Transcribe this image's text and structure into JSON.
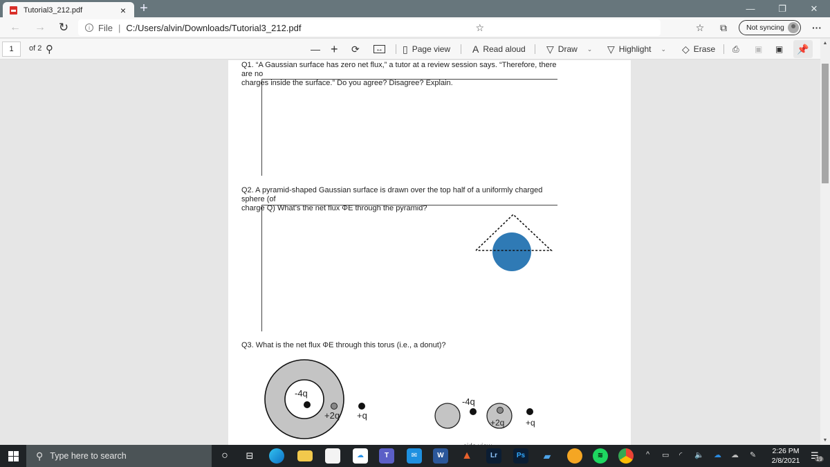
{
  "browser": {
    "tab_title": "Tutorial3_212.pdf",
    "tab_close": "×",
    "new_tab": "+",
    "window_controls": {
      "minimize": "—",
      "maximize": "❐",
      "close": "✕"
    },
    "address": {
      "scheme_label": "File",
      "separator": "|",
      "url": "C:/Users/alvin/Downloads/Tutorial3_212.pdf"
    },
    "nav": {
      "back": "←",
      "forward": "→",
      "refresh": "↻"
    },
    "toolbar_icons": [
      "add-favorite-icon",
      "favorites-icon",
      "collections-icon",
      "more-icon"
    ],
    "sync_label": "Not syncing",
    "more": "···"
  },
  "pdf_toolbar": {
    "page_current": "1",
    "page_total": "of 2",
    "zoom_out": "—",
    "zoom_in": "+",
    "page_view": "Page view",
    "read_aloud": "Read aloud",
    "draw": "Draw",
    "highlight": "Highlight",
    "erase": "Erase"
  },
  "document": {
    "q1_line1": "Q1. “A Gaussian surface has zero net flux,” a tutor at a review session says. “Therefore, there are no",
    "q1_line2": "charges inside the surface.” Do you agree? Disagree? Explain.",
    "q2_line1": "Q2.  A pyramid-shaped Gaussian surface is drawn over the top half of a uniformly charged sphere (of",
    "q2_line2": "charge Q) What’s the net flux ΦE through the pyramid?",
    "q3_text": "Q3. What is the net flux ΦE through this torus (i.e., a donut)?",
    "sphere_color": "#2f7ab5",
    "torus_labels": {
      "inner": "-4q",
      "mid": "+2q",
      "outer": "+q"
    },
    "side_labels": {
      "inner": "-4q",
      "mid": "+2q",
      "outer": "+q"
    },
    "side_caption": "side view"
  },
  "taskbar": {
    "search_placeholder": "Type here to search",
    "apps": [
      "cortana",
      "task-view",
      "edge",
      "file-explorer",
      "store",
      "icloud",
      "teams",
      "mail",
      "word",
      "matlab",
      "lightroom",
      "photoshop",
      "network-app",
      "weather",
      "spotify",
      "chrome"
    ],
    "app_labels": {
      "word": "W",
      "lightroom": "Lr",
      "photoshop": "Ps"
    },
    "time": "2:26 PM",
    "date": "2/8/2021",
    "notifications": "19"
  }
}
